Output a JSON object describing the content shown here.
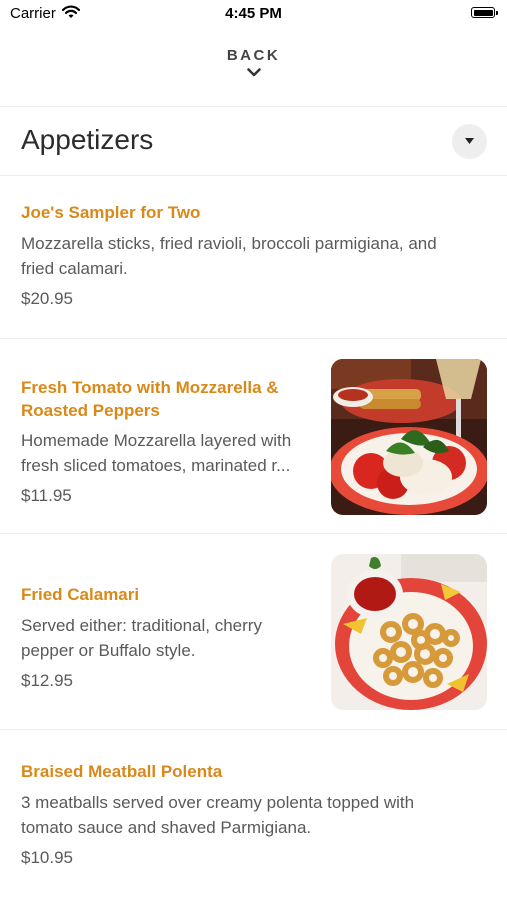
{
  "status_bar": {
    "carrier": "Carrier",
    "time": "4:45 PM"
  },
  "nav": {
    "back_label": "BACK"
  },
  "section": {
    "title": "Appetizers"
  },
  "colors": {
    "accent": "#d9891a",
    "text": "#5a5a5a",
    "divider": "#ececec"
  },
  "items": [
    {
      "name_lines": [
        "Joe's Sampler for Two"
      ],
      "desc_lines": [
        "Mozzarella sticks, fried ravioli, broccoli parmigiana, and",
        "fried calamari."
      ],
      "price": "$20.95"
    },
    {
      "name_lines": [
        "Fresh Tomato with Mozzarella &",
        "Roasted Peppers"
      ],
      "desc_lines": [
        "Homemade Mozzarella layered with",
        "fresh sliced tomatoes, marinated r..."
      ],
      "price": "$11.95",
      "image": "caprese-salad-photo"
    },
    {
      "name_lines": [
        "Fried Calamari"
      ],
      "desc_lines": [
        "Served either: traditional, cherry",
        "pepper or Buffalo style."
      ],
      "price": "$12.95",
      "image": "fried-calamari-photo"
    },
    {
      "name_lines": [
        "Braised Meatball Polenta"
      ],
      "desc_lines": [
        "3 meatballs served over creamy polenta topped with",
        "tomato sauce and shaved Parmigiana."
      ],
      "price": "$10.95"
    }
  ]
}
